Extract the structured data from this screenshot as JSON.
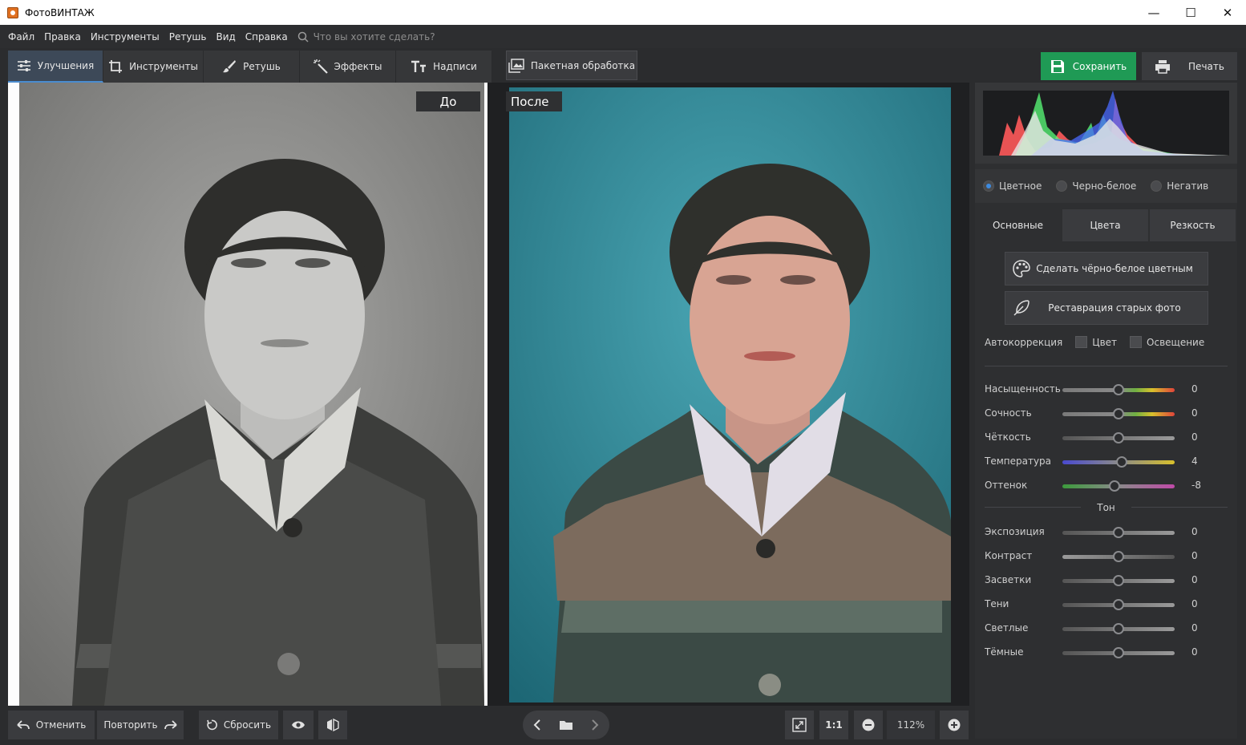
{
  "window": {
    "title": "ФотоВИНТАЖ",
    "minimize": "—",
    "maximize": "☐",
    "close": "✕"
  },
  "menu": {
    "items": [
      "Файл",
      "Правка",
      "Инструменты",
      "Ретушь",
      "Вид",
      "Справка"
    ],
    "search_placeholder": "Что вы хотите сделать?"
  },
  "toolbar": {
    "tabs": [
      "Улучшения",
      "Инструменты",
      "Ретушь",
      "Эффекты",
      "Надписи"
    ],
    "batch": "Пакетная обработка",
    "save": "Сохранить",
    "print": "Печать"
  },
  "canvas": {
    "before_label": "До",
    "after_label": "После"
  },
  "bottom": {
    "undo": "Отменить",
    "redo": "Повторить",
    "reset": "Сбросить",
    "zoom_one": "1:1",
    "zoom_value": "112%"
  },
  "panel": {
    "modes": [
      "Цветное",
      "Черно-белое",
      "Негатив"
    ],
    "selected_mode": "Цветное",
    "tabs": [
      "Основные",
      "Цвета",
      "Резкость"
    ],
    "colorize_button": "Сделать чёрно-белое цветным",
    "restore_button": "Реставрация старых фото",
    "autocorrection": {
      "label": "Автокоррекция",
      "color": "Цвет",
      "lighting": "Освещение"
    },
    "sliders": [
      {
        "label": "Насыщенность",
        "value": "0"
      },
      {
        "label": "Сочность",
        "value": "0"
      },
      {
        "label": "Чёткость",
        "value": "0"
      },
      {
        "label": "Температура",
        "value": "4"
      },
      {
        "label": "Оттенок",
        "value": "-8"
      }
    ],
    "tone_label": "Тон",
    "tone_sliders": [
      {
        "label": "Экспозиция",
        "value": "0"
      },
      {
        "label": "Контраст",
        "value": "0"
      },
      {
        "label": "Засветки",
        "value": "0"
      },
      {
        "label": "Тени",
        "value": "0"
      },
      {
        "label": "Светлые",
        "value": "0"
      },
      {
        "label": "Тёмные",
        "value": "0"
      }
    ]
  },
  "colors": {
    "accent": "#3d8be0",
    "save": "#1f9a55"
  }
}
